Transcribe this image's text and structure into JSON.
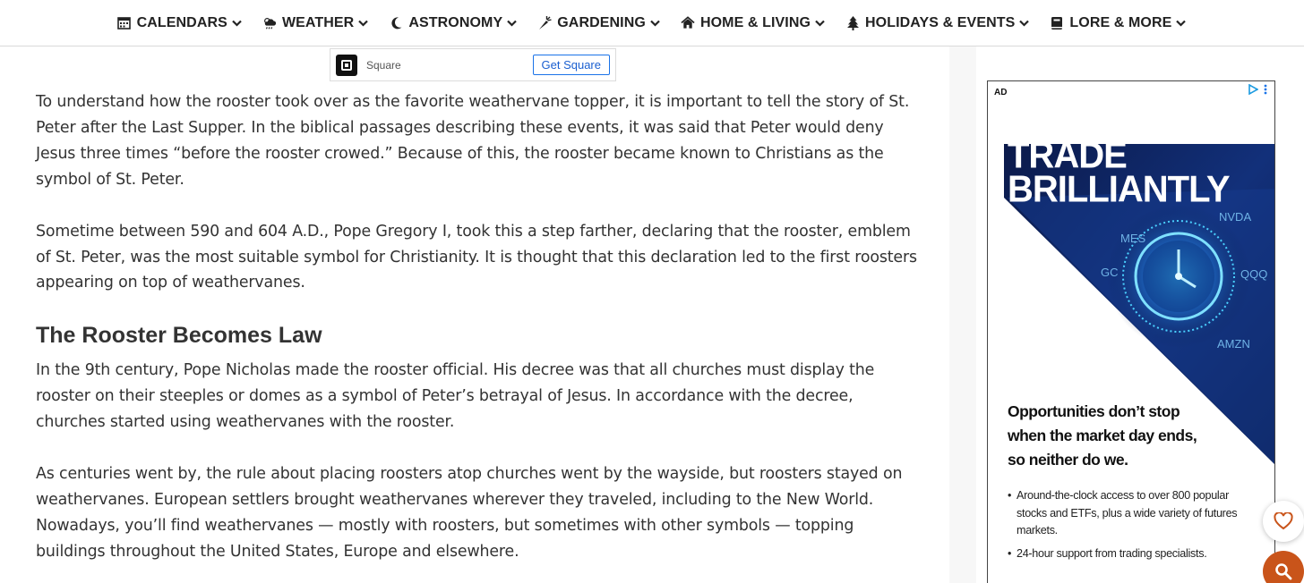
{
  "nav": {
    "items": [
      {
        "label": "CALENDARS",
        "icon": "calendar-icon"
      },
      {
        "label": "WEATHER",
        "icon": "weather-icon"
      },
      {
        "label": "ASTRONOMY",
        "icon": "moon-icon"
      },
      {
        "label": "GARDENING",
        "icon": "carrot-icon"
      },
      {
        "label": "HOME & LIVING",
        "icon": "home-icon"
      },
      {
        "label": "HOLIDAYS & EVENTS",
        "icon": "tree-icon"
      },
      {
        "label": "LORE & MORE",
        "icon": "book-icon"
      }
    ]
  },
  "top_ad": {
    "brand": "Square",
    "button_label": "Get Square"
  },
  "article": {
    "p1": "To understand how the rooster took over as the favorite weathervane topper, it is important to tell the story of St. Peter after the Last Supper. In the biblical passages describing these events, it was said that Peter would deny Jesus three times “before the rooster crowed.” Because of this, the rooster became known to Christians as the symbol of St. Peter.",
    "p2": "Sometime between 590 and 604 A.D., Pope Gregory I, took this a step farther, declaring that the rooster, emblem of St. Peter, was the most suitable symbol for Christianity. It is thought that this declaration led to the first roosters appearing on top of weathervanes.",
    "heading": "The Rooster Becomes Law",
    "p3": "In the 9th century, Pope Nicholas made the rooster official. His decree was that all churches must display the rooster on their steeples or domes as a symbol of Peter’s betrayal of Jesus. In accordance with the decree, churches started using weathervanes with the rooster.",
    "p4": "As centuries went by, the rule about placing roosters atop churches went by the wayside, but roosters stayed on weathervanes. European settlers brought weathervanes wherever they traveled, including to the New World. Nowadays, you’ll find weathervanes — mostly with roosters, but sometimes with other symbols — topping buildings throughout the United States, Europe and elsewhere."
  },
  "side_ad": {
    "label": "AD",
    "headline_line1": "TRADE",
    "headline_line2": "BRILLIANTLY",
    "tickers": [
      "NVDA",
      "MES",
      "GC",
      "QQQ",
      "AMZN"
    ],
    "tagline": "Opportunities don’t stop when the market day ends, so neither do we.",
    "bullets": [
      "Around-the-clock access to over 800 popular stocks and ETFs, plus a wide variety of futures markets.",
      "24-hour support from trading specialists."
    ],
    "colors": {
      "navy": "#0b1a4a",
      "blue": "#1e4fa8",
      "glow": "#3ec6ff"
    }
  },
  "fab": {
    "heart_icon": "heart-icon",
    "search_icon": "search-icon",
    "accent": "#c9541a"
  }
}
